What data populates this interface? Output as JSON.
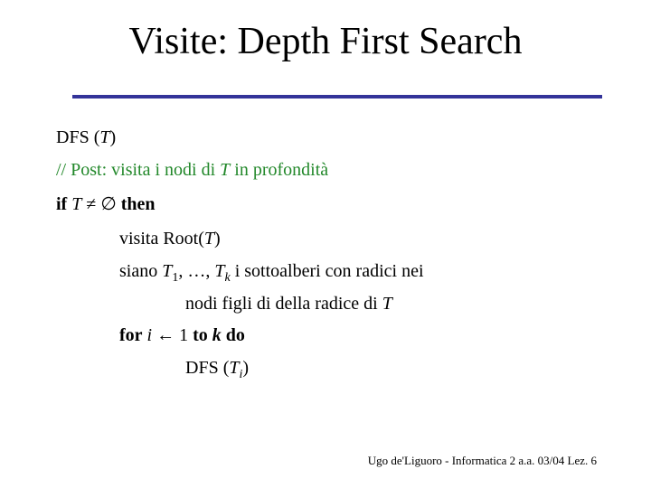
{
  "slide": {
    "title": "Visite: Depth First Search",
    "rule_color": "#333399",
    "comment_color": "#22882a",
    "code": {
      "l1": {
        "fn": "DFS",
        "open": " (",
        "arg": "T",
        "close": ")"
      },
      "l2": {
        "pre": "// Post: visita i nodi di ",
        "var": "T",
        "post": " in profondità"
      },
      "l3": {
        "kw_if": "if",
        "var": "T",
        "op": " ≠ ∅ ",
        "kw_then": "then"
      },
      "l4": {
        "pre": "visita Root(",
        "var": "T",
        "post": ")"
      },
      "l5": {
        "pre": "siano ",
        "v1": "T",
        "s1": "1",
        "mid": ", …, ",
        "v2": "T",
        "s2": "k",
        "post": " i sottoalberi con radici nei"
      },
      "l6": {
        "pre": "nodi figli di della radice di ",
        "var": "T"
      },
      "l7": {
        "kw_for": "for",
        "var_i": "i",
        "arrow": " ← 1 ",
        "kw_to": "to",
        "var_k": "k",
        "kw_do": "do"
      },
      "l8": {
        "fn": "DFS (",
        "var": "T",
        "sub": "i",
        "close": ")"
      }
    },
    "footer": "Ugo de'Liguoro - Informatica 2 a.a. 03/04 Lez. 6"
  }
}
